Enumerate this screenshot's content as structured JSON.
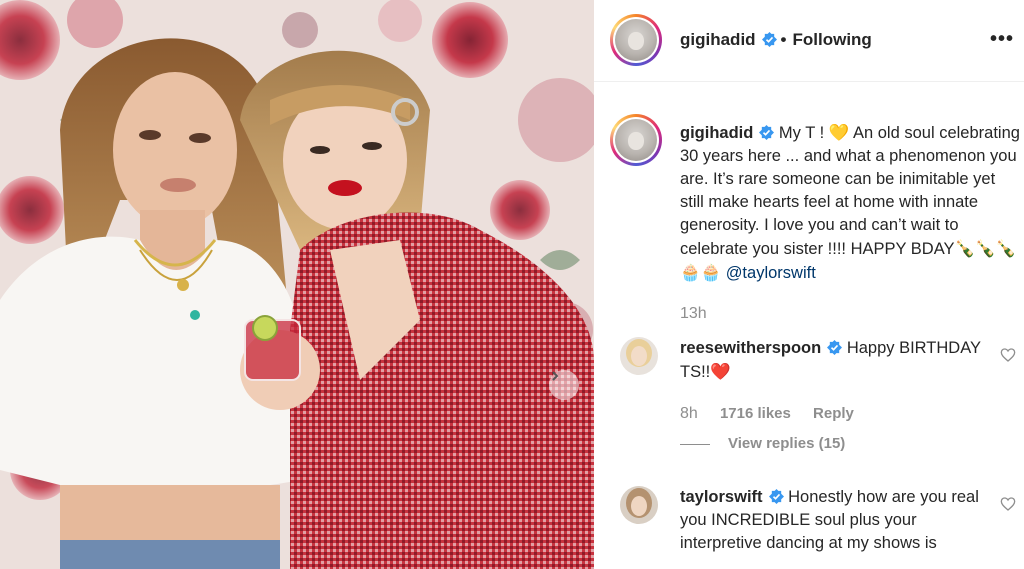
{
  "post": {
    "username": "gigihadid",
    "follow_status": "Following",
    "more_icon": "more-options-icon"
  },
  "caption": {
    "username": "gigihadid",
    "text_part1": "My T !",
    "text_part2": "An old soul celebrating 30 years here ... and what a phenomenon you are. It’s rare someone can be inimitable yet still make hearts feel at home with innate generosity. I love you and can’t wait to celebrate you sister !!!! HAPPY BDAY",
    "emoji_heart": "💛",
    "emoji_trail": "🍾🍾🍾🧁🧁",
    "mention": "@taylorswift",
    "time": "13h"
  },
  "comments": [
    {
      "username": "reesewitherspoon",
      "text": "Happy BIRTHDAY TS!!",
      "emoji": "❤️",
      "time": "8h",
      "likes": "1716 likes",
      "reply_label": "Reply",
      "view_replies": "View replies (15)"
    },
    {
      "username": "taylorswift",
      "text": "Honestly how are you real you INCREDIBLE soul plus your interpretive dancing at my shows is"
    }
  ],
  "colors": {
    "verified_blue": "#3897f0",
    "text": "#262626",
    "muted": "#8e8e8e",
    "link": "#00376b",
    "jacket_red": "#b82a35"
  }
}
